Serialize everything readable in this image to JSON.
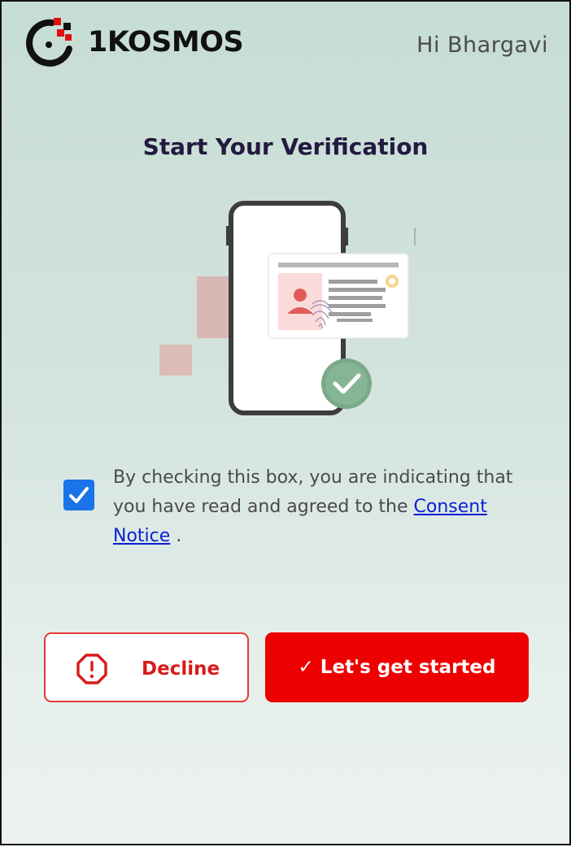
{
  "header": {
    "brand_name": "1KOSMOS",
    "greeting": "Hi Bhargavi"
  },
  "main": {
    "title": "Start Your Verification",
    "consent": {
      "checked": true,
      "text_before": "By checking this box, you are indicating that you have read and agreed to the",
      "link_label": "Consent Notice",
      "text_after": "."
    }
  },
  "buttons": {
    "decline_label": "Decline",
    "start_label": "✓ Let's get started"
  },
  "icons": {
    "logo": "logo-icon",
    "illustration": "verification-illustration",
    "checkbox": "checkmark-icon",
    "decline": "alert-octagon-icon"
  },
  "colors": {
    "primary_red": "#ee0000",
    "checkbox_blue": "#1a73e8",
    "link_blue": "#0b1fd6",
    "title_color": "#24193f"
  }
}
